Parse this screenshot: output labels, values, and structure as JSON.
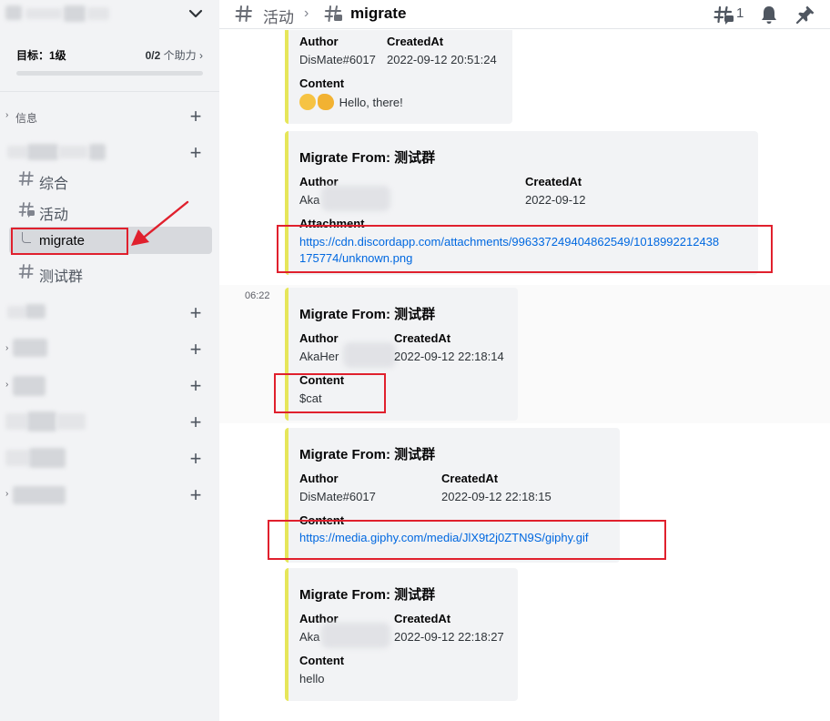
{
  "sidebar": {
    "goal_label": "目标：1级",
    "boost_count": "0/2",
    "boost_text": "个助力",
    "boost_progress": 0,
    "category_info": "信息",
    "channels": [
      {
        "label": "综合",
        "icon": "hash-icon"
      },
      {
        "label": "活动",
        "icon": "thread-hash-icon"
      },
      {
        "label": "migrate",
        "icon": "thread-spine-icon"
      },
      {
        "label": "测试群",
        "icon": "hash-icon"
      }
    ]
  },
  "header": {
    "parent_channel": "活动",
    "thread_name": "migrate",
    "threads_count": "1"
  },
  "messages": [
    {
      "author_label": "Author",
      "author": "DisMate#6017",
      "created_label": "CreatedAt",
      "created": "2022-09-12 20:51:24",
      "content_label": "Content",
      "content": "Hello, there!"
    },
    {
      "title": "Migrate From: 测试群",
      "author_label": "Author",
      "author": "Aka",
      "created_label": "CreatedAt",
      "created": "2022-09-12",
      "attach_label": "Attachment",
      "attach_line1": "https://cdn.discordapp.com/attachments/996337249404862549/1018992212438",
      "attach_line2": "175774/unknown.png"
    },
    {
      "timestamp": "06:22",
      "title": "Migrate From: 测试群",
      "author_label": "Author",
      "author": "AkaHer",
      "created_label": "CreatedAt",
      "created": "2022-09-12 22:18:14",
      "content_label": "Content",
      "content": "$cat"
    },
    {
      "title": "Migrate From: 测试群",
      "author_label": "Author",
      "author": "DisMate#6017",
      "created_label": "CreatedAt",
      "created": "2022-09-12 22:18:15",
      "content_label": "Content",
      "content": "https://media.giphy.com/media/JlX9t2j0ZTN9S/giphy.gif"
    },
    {
      "title": "Migrate From: 测试群",
      "author_label": "Author",
      "author": "Aka",
      "created_label": "CreatedAt",
      "created": "2022-09-12 22:18:27",
      "content_label": "Content",
      "content": "hello"
    }
  ],
  "colors": {
    "accent_bar": "#e6e65a",
    "link": "#0068e0",
    "annotation": "#e0202d"
  }
}
